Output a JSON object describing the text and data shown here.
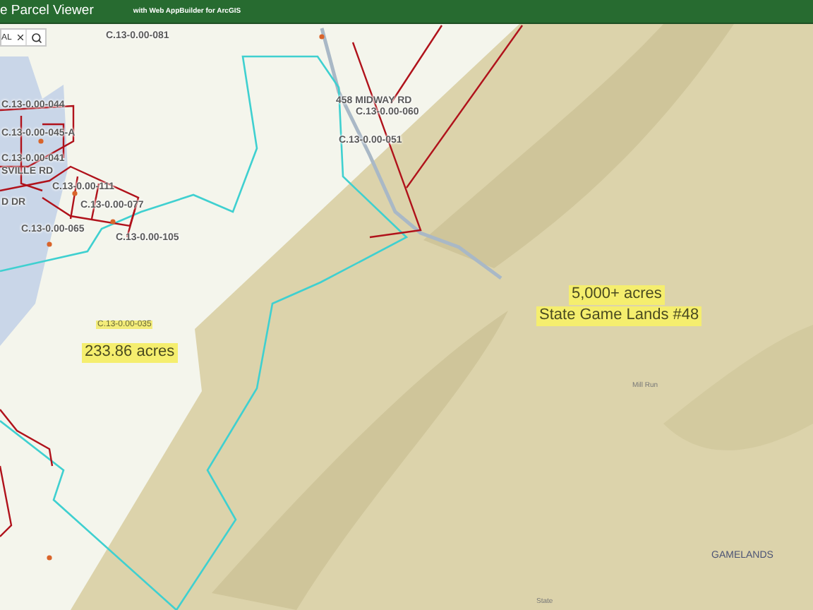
{
  "header": {
    "title": "e Parcel Viewer",
    "subtitle": "with Web AppBuilder for ArcGIS"
  },
  "search": {
    "value": "AL"
  },
  "map_labels": [
    {
      "text": "C.13-0.00-081",
      "kind": "parcel"
    },
    {
      "text": "C.13-0.00-044",
      "kind": "parcel"
    },
    {
      "text": "C.13-0.00-045-A",
      "kind": "parcel"
    },
    {
      "text": "C.13-0.00-041",
      "kind": "parcel"
    },
    {
      "text": "SVILLE RD",
      "kind": "parcel"
    },
    {
      "text": "D DR",
      "kind": "parcel"
    },
    {
      "text": "C.13-0.00-111",
      "kind": "parcel"
    },
    {
      "text": "C.13-0.00-077",
      "kind": "parcel"
    },
    {
      "text": "C.13-0.00-065",
      "kind": "parcel"
    },
    {
      "text": "C.13-0.00-105",
      "kind": "parcel"
    },
    {
      "text": "458 MIDWAY RD",
      "kind": "parcel"
    },
    {
      "text": "C.13-0.00-060",
      "kind": "parcel"
    },
    {
      "text": "C.13-0.00-051",
      "kind": "parcel"
    },
    {
      "text": "C.13-0.00-035",
      "kind": "highlight-small"
    },
    {
      "text": "233.86 acres",
      "kind": "highlight"
    },
    {
      "text": "5,000+ acres",
      "kind": "highlight"
    },
    {
      "text": "State Game Lands #48",
      "kind": "highlight"
    },
    {
      "text": "Mill Run",
      "kind": "feature"
    },
    {
      "text": "GAMELANDS",
      "kind": "area"
    },
    {
      "text": "State",
      "kind": "feature"
    }
  ]
}
